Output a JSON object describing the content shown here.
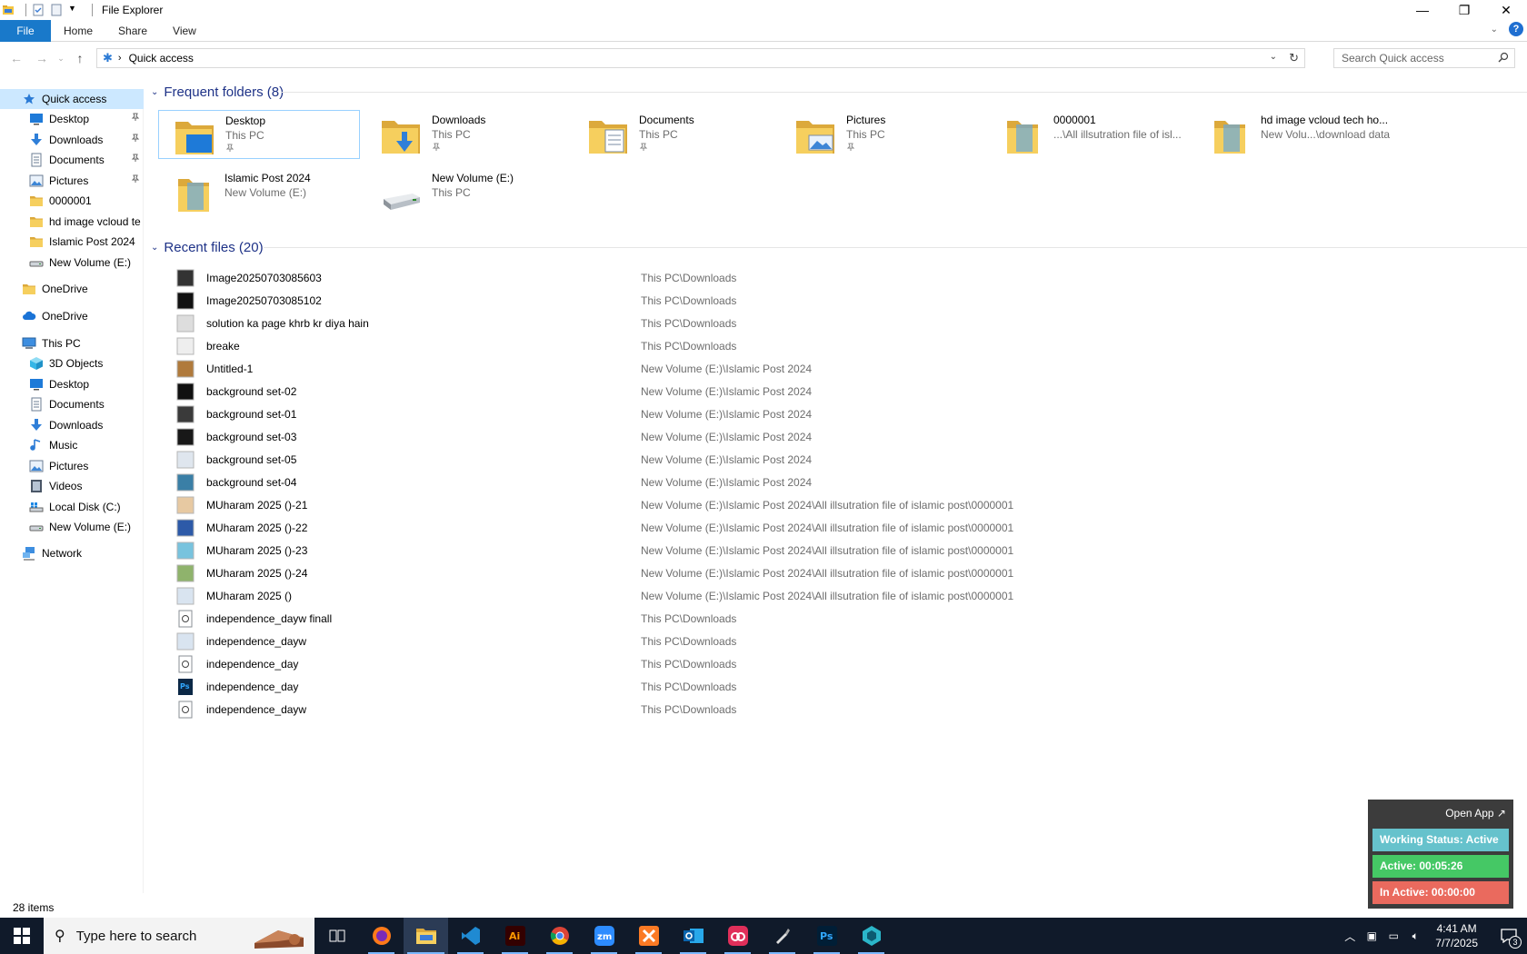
{
  "window": {
    "title": "File Explorer",
    "controls": {
      "minimize": "—",
      "maximize": "❐",
      "close": "✕"
    }
  },
  "ribbon": {
    "tabs": [
      "File",
      "Home",
      "Share",
      "View"
    ]
  },
  "address": {
    "crumb": "Quick access",
    "search_placeholder": "Search Quick access"
  },
  "sidebar": {
    "items": [
      {
        "label": "Quick access",
        "icon": "star-icon",
        "indent": 0,
        "selected": true
      },
      {
        "label": "Desktop",
        "icon": "desktop-icon",
        "indent": 1,
        "pinned": true
      },
      {
        "label": "Downloads",
        "icon": "download-icon",
        "indent": 1,
        "pinned": true
      },
      {
        "label": "Documents",
        "icon": "document-icon",
        "indent": 1,
        "pinned": true
      },
      {
        "label": "Pictures",
        "icon": "pictures-icon",
        "indent": 1,
        "pinned": true
      },
      {
        "label": "0000001",
        "icon": "folder-icon",
        "indent": 1
      },
      {
        "label": "hd image vcloud te",
        "icon": "folder-icon",
        "indent": 1
      },
      {
        "label": "Islamic Post 2024",
        "icon": "folder-icon",
        "indent": 1
      },
      {
        "label": "New Volume (E:)",
        "icon": "drive-icon",
        "indent": 1
      },
      {
        "label": "OneDrive",
        "icon": "folder-icon",
        "indent": 0
      },
      {
        "label": "OneDrive",
        "icon": "cloud-icon",
        "indent": 0
      },
      {
        "label": "This PC",
        "icon": "pc-icon",
        "indent": 0
      },
      {
        "label": "3D Objects",
        "icon": "cube-icon",
        "indent": 1
      },
      {
        "label": "Desktop",
        "icon": "desktop-icon",
        "indent": 1
      },
      {
        "label": "Documents",
        "icon": "document-icon",
        "indent": 1
      },
      {
        "label": "Downloads",
        "icon": "download-icon",
        "indent": 1
      },
      {
        "label": "Music",
        "icon": "music-icon",
        "indent": 1
      },
      {
        "label": "Pictures",
        "icon": "pictures-icon",
        "indent": 1
      },
      {
        "label": "Videos",
        "icon": "video-icon",
        "indent": 1
      },
      {
        "label": "Local Disk (C:)",
        "icon": "windows-drive-icon",
        "indent": 1
      },
      {
        "label": "New Volume (E:)",
        "icon": "drive-icon",
        "indent": 1
      },
      {
        "label": "Network",
        "icon": "network-icon",
        "indent": 0
      }
    ]
  },
  "frequent": {
    "header": "Frequent folders (8)",
    "tiles": [
      {
        "name": "Desktop",
        "sub": "This PC",
        "pinned": true,
        "icon": "desktop-folder-icon",
        "selected": true
      },
      {
        "name": "Downloads",
        "sub": "This PC",
        "pinned": true,
        "icon": "downloads-folder-icon"
      },
      {
        "name": "Documents",
        "sub": "This PC",
        "pinned": true,
        "icon": "documents-folder-icon"
      },
      {
        "name": "Pictures",
        "sub": "This PC",
        "pinned": true,
        "icon": "pictures-folder-icon"
      },
      {
        "name": "0000001",
        "sub": "...\\All illsutration file of isl...",
        "icon": "folder-icon"
      },
      {
        "name": "hd image vcloud tech ho...",
        "sub": "New Volu...\\download data",
        "icon": "folder-icon"
      },
      {
        "name": "Islamic Post 2024",
        "sub": "New Volume (E:)",
        "icon": "folder-icon"
      },
      {
        "name": "New Volume (E:)",
        "sub": "This PC",
        "icon": "drive-icon"
      }
    ]
  },
  "recent": {
    "header": "Recent files (20)",
    "files": [
      {
        "name": "Image20250703085603",
        "loc": "This PC\\Downloads",
        "icon": "image-file-icon"
      },
      {
        "name": "Image20250703085102",
        "loc": "This PC\\Downloads",
        "icon": "image-file-icon"
      },
      {
        "name": "solution ka page khrb kr diya hain",
        "loc": "This PC\\Downloads",
        "icon": "image-file-icon"
      },
      {
        "name": "breake",
        "loc": "This PC\\Downloads",
        "icon": "image-file-icon"
      },
      {
        "name": "Untitled-1",
        "loc": "New Volume (E:)\\Islamic Post 2024",
        "icon": "image-file-icon"
      },
      {
        "name": "background set-02",
        "loc": "New Volume (E:)\\Islamic Post 2024",
        "icon": "image-file-icon"
      },
      {
        "name": "background set-01",
        "loc": "New Volume (E:)\\Islamic Post 2024",
        "icon": "image-file-icon"
      },
      {
        "name": "background set-03",
        "loc": "New Volume (E:)\\Islamic Post 2024",
        "icon": "image-file-icon"
      },
      {
        "name": "background set-05",
        "loc": "New Volume (E:)\\Islamic Post 2024",
        "icon": "image-file-icon"
      },
      {
        "name": "background set-04",
        "loc": "New Volume (E:)\\Islamic Post 2024",
        "icon": "image-file-icon"
      },
      {
        "name": "MUharam 2025 ()-21",
        "loc": "New Volume (E:)\\Islamic Post 2024\\All illsutration file of islamic post\\0000001",
        "icon": "image-file-icon"
      },
      {
        "name": "MUharam 2025 ()-22",
        "loc": "New Volume (E:)\\Islamic Post 2024\\All illsutration file of islamic post\\0000001",
        "icon": "image-file-icon"
      },
      {
        "name": "MUharam 2025 ()-23",
        "loc": "New Volume (E:)\\Islamic Post 2024\\All illsutration file of islamic post\\0000001",
        "icon": "image-file-icon"
      },
      {
        "name": "MUharam 2025 ()-24",
        "loc": "New Volume (E:)\\Islamic Post 2024\\All illsutration file of islamic post\\0000001",
        "icon": "image-file-icon"
      },
      {
        "name": "MUharam 2025 ()",
        "loc": "New Volume (E:)\\Islamic Post 2024\\All illsutration file of islamic post\\0000001",
        "icon": "image-file-icon"
      },
      {
        "name": "independence_dayw finall",
        "loc": "This PC\\Downloads",
        "icon": "generic-file-icon"
      },
      {
        "name": "independence_dayw",
        "loc": "This PC\\Downloads",
        "icon": "image-file-icon"
      },
      {
        "name": "independence_day",
        "loc": "This PC\\Downloads",
        "icon": "generic-file-icon"
      },
      {
        "name": "independence_day",
        "loc": "This PC\\Downloads",
        "icon": "photoshop-file-icon"
      },
      {
        "name": "independence_dayw",
        "loc": "This PC\\Downloads",
        "icon": "generic-file-icon"
      }
    ]
  },
  "status": {
    "items": "28 items"
  },
  "tracker": {
    "open_app": "Open App ↗",
    "working": "Working Status: Active",
    "active": "Active: 00:05:26",
    "inactive": "In Active: 00:00:00"
  },
  "taskbar": {
    "search_placeholder": "Type here to search",
    "apps": [
      {
        "name": "task-view-icon",
        "glyph": "▯▯"
      },
      {
        "name": "firefox-icon",
        "glyph": ""
      },
      {
        "name": "file-explorer-icon",
        "glyph": "",
        "active": true
      },
      {
        "name": "vscode-icon",
        "glyph": ""
      },
      {
        "name": "illustrator-icon",
        "glyph": "Ai"
      },
      {
        "name": "chrome-icon",
        "glyph": ""
      },
      {
        "name": "zoom-icon",
        "glyph": "zm"
      },
      {
        "name": "xampp-icon",
        "glyph": ""
      },
      {
        "name": "outlook-icon",
        "glyph": ""
      },
      {
        "name": "creative-cloud-icon",
        "glyph": ""
      },
      {
        "name": "pen-tool-icon",
        "glyph": ""
      },
      {
        "name": "photoshop-icon",
        "glyph": "Ps"
      },
      {
        "name": "tracker-app-icon",
        "glyph": ""
      }
    ],
    "time": "4:41 AM",
    "date": "7/7/2025",
    "notifications": "3"
  }
}
